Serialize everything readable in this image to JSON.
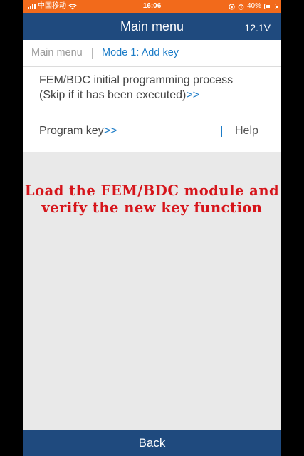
{
  "status_bar": {
    "carrier": "中国移动",
    "time": "16:06",
    "battery_percent": "40%",
    "battery_level": 0.4,
    "background_color": "#f26a1b",
    "icons": [
      "signal-icon",
      "wifi-icon",
      "lock-rotation-icon",
      "alarm-icon",
      "battery-icon"
    ]
  },
  "header": {
    "title": "Main menu",
    "voltage": "12.1V",
    "background_color": "#1f4a7e"
  },
  "breadcrumb": {
    "root": "Main menu",
    "current": "Mode 1: Add key"
  },
  "menu_items": [
    {
      "line1": "FEM/BDC initial programming process",
      "line2": "(Skip if it has been executed)",
      "arrow": ">>"
    },
    {
      "label": "Program key",
      "arrow": ">>",
      "help": "Help"
    }
  ],
  "overlay_caption": {
    "line1": "Load the FEM/BDC module and",
    "line2": "verify the new key function",
    "color": "#d6151b"
  },
  "footer": {
    "back_label": "Back"
  }
}
